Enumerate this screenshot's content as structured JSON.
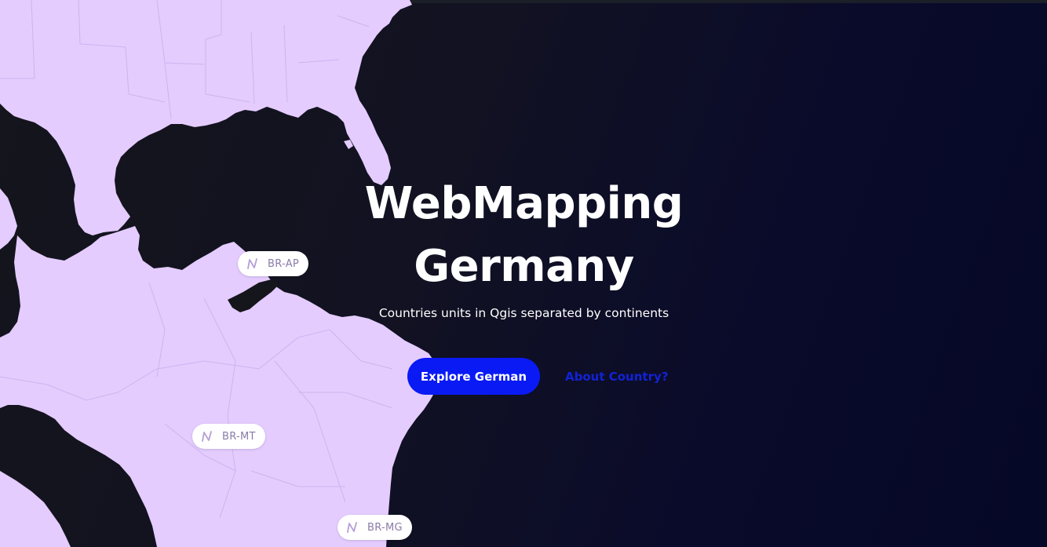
{
  "hero": {
    "title_line1": "WebMapping",
    "title_line2": "Germany",
    "subtitle": "Countries units in Qgis separated by continents",
    "primary_cta": "Explore German",
    "secondary_cta": "About Country?"
  },
  "map": {
    "land_color": "#e4ccff",
    "labels": [
      {
        "code": "BR-AP"
      },
      {
        "code": "BR-MT"
      },
      {
        "code": "BR-MG"
      }
    ],
    "label_icon": "n-logo-icon"
  },
  "theme": {
    "background": "#0a0b2a",
    "accent": "#0a1af5"
  }
}
